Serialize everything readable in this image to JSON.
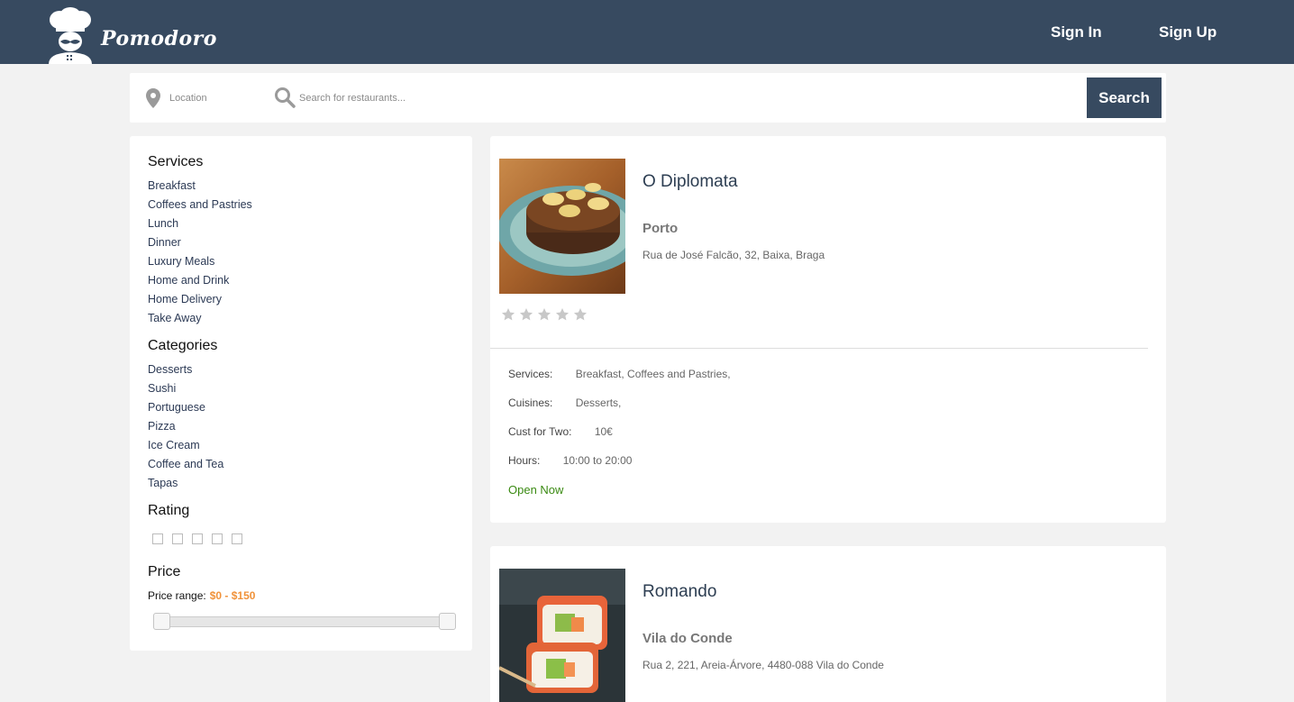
{
  "header": {
    "brand": "Pomodoro",
    "sign_in": "Sign In",
    "sign_up": "Sign Up",
    "color": "#374a60"
  },
  "search": {
    "location_placeholder": "Location",
    "query_placeholder": "Search for restaurants...",
    "button_label": "Search"
  },
  "filters": {
    "services_title": "Services",
    "services": [
      "Breakfast",
      "Coffees and Pastries",
      "Lunch",
      "Dinner",
      "Luxury Meals",
      "Home and Drink",
      "Home Delivery",
      "Take Away"
    ],
    "categories_title": "Categories",
    "categories": [
      "Desserts",
      "Sushi",
      "Portuguese",
      "Pizza",
      "Ice Cream",
      "Coffee and Tea",
      "Tapas"
    ],
    "rating_title": "Rating",
    "price_title": "Price",
    "price_range_label": "Price range:",
    "price_range_value": "$0 - $150",
    "accent_color": "#f0923a"
  },
  "restaurants": [
    {
      "name": "O Diplomata",
      "city": "Porto",
      "address": "Rua de José Falcão, 32, Baixa, Braga",
      "rating": 0,
      "services_label": "Services:",
      "services_value": "Breakfast, Coffees and Pastries,",
      "cuisines_label": "Cuisines:",
      "cuisines_value": "Desserts,",
      "cost_label": "Cust for Two:",
      "cost_value": "10€",
      "hours_label": "Hours:",
      "hours_value": "10:00 to 20:00",
      "status": "Open Now",
      "thumb_icon": "pancakes-photo"
    },
    {
      "name": "Romando",
      "city": "Vila do Conde",
      "address": "Rua 2, 221, Areia-Árvore, 4480-088 Vila do Conde",
      "thumb_icon": "sushi-photo"
    }
  ]
}
